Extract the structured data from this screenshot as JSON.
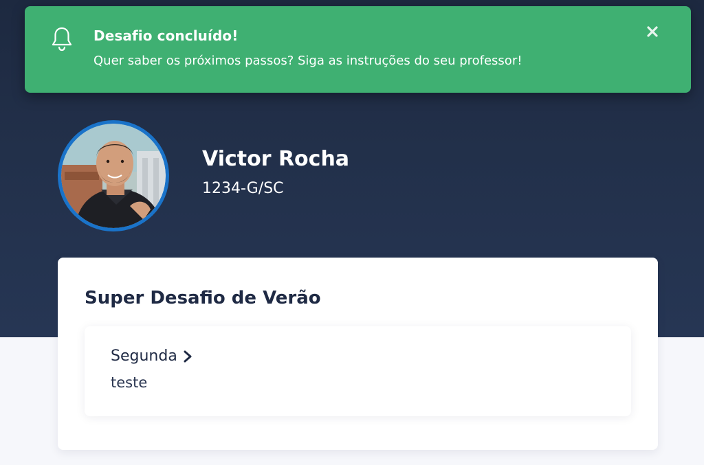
{
  "toast": {
    "title": "Desafio concluído!",
    "message": "Quer saber os próximos passos? Siga as instruções do seu professor!",
    "icon": "bell-icon",
    "close_icon": "close-icon",
    "color": "#3fb072"
  },
  "profile": {
    "name": "Victor Rocha",
    "code": "1234-G/SC",
    "ring_color": "#1a73c9"
  },
  "challenge": {
    "title": "Super Desafio de Verão",
    "items": [
      {
        "title": "Segunda",
        "description": "teste",
        "icon": "chevron-right-icon"
      }
    ]
  },
  "colors": {
    "header_bg": "#1d2940",
    "page_bg": "#f6f7fb",
    "text_dark": "#1f2a44"
  }
}
